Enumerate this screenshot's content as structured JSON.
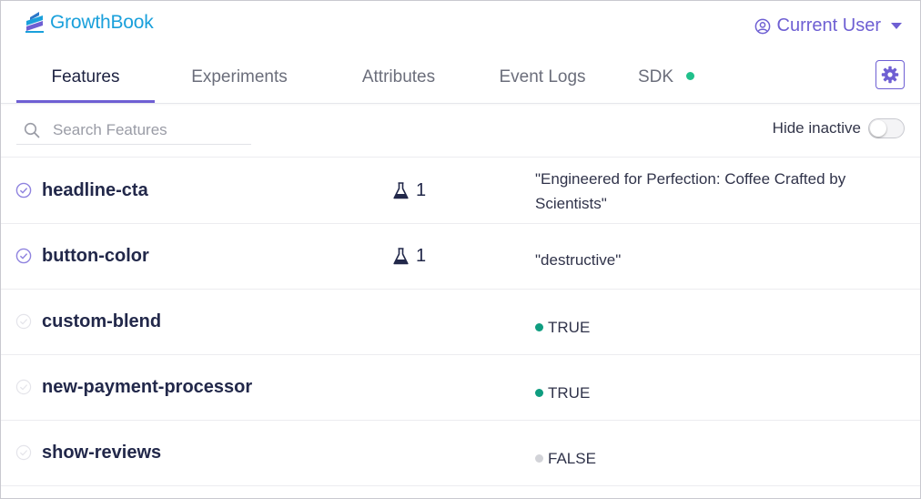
{
  "brand": {
    "name": "GrowthBook",
    "color": "#1aa0db",
    "accent": "#6e5fd3"
  },
  "user": {
    "label": "Current User"
  },
  "tabs": [
    {
      "label": "Features",
      "active": true
    },
    {
      "label": "Experiments",
      "active": false
    },
    {
      "label": "Attributes",
      "active": false
    },
    {
      "label": "Event Logs",
      "active": false
    },
    {
      "label": "SDK",
      "active": false,
      "status": "connected",
      "status_color": "#20c08b"
    }
  ],
  "search": {
    "placeholder": "Search Features",
    "value": ""
  },
  "filters": {
    "hide_inactive_label": "Hide inactive",
    "hide_inactive": false
  },
  "features": [
    {
      "name": "headline-cta",
      "enabled": true,
      "experiments": "1",
      "value": "\"Engineered for Perfection: Coffee Crafted by Scientists\""
    },
    {
      "name": "button-color",
      "enabled": true,
      "experiments": "1",
      "value": "\"destructive\""
    },
    {
      "name": "custom-blend",
      "enabled": false,
      "experiments": "",
      "value": "TRUE",
      "bool_color": "#0f9d80"
    },
    {
      "name": "new-payment-processor",
      "enabled": false,
      "experiments": "",
      "value": "TRUE",
      "bool_color": "#0f9d80"
    },
    {
      "name": "show-reviews",
      "enabled": false,
      "experiments": "",
      "value": "FALSE",
      "bool_color": "#d2d3d8"
    }
  ]
}
